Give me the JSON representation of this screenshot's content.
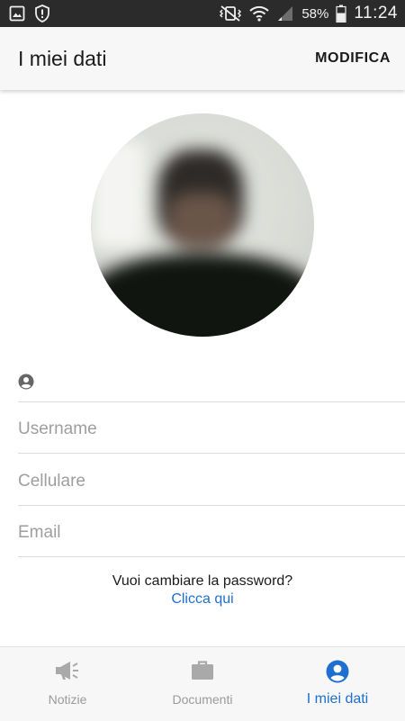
{
  "status_bar": {
    "battery_percent": "58%",
    "time": "11:24",
    "left_icons": [
      "image-icon",
      "shield-alert-icon"
    ],
    "right_icons": [
      "vibrate-mute-icon",
      "wifi-icon",
      "cellular-signal-icon",
      "battery-icon"
    ]
  },
  "app_bar": {
    "title": "I miei dati",
    "action_label": "MODIFICA"
  },
  "profile": {
    "avatar": "profile-photo",
    "user_icon": "account-circle-icon"
  },
  "form": {
    "username_placeholder": "Username",
    "username_value": "",
    "phone_placeholder": "Cellulare",
    "phone_value": "",
    "email_placeholder": "Email",
    "email_value": ""
  },
  "password": {
    "question": "Vuoi cambiare la password?",
    "link": "Clicca qui"
  },
  "bottom_nav": {
    "items": [
      {
        "label": "Notizie",
        "icon": "megaphone-icon",
        "active": false
      },
      {
        "label": "Documenti",
        "icon": "briefcase-icon",
        "active": false
      },
      {
        "label": "I miei dati",
        "icon": "account-circle-icon",
        "active": true
      }
    ]
  },
  "colors": {
    "accent": "#1f6fd0",
    "inactive_nav": "#9a9a9a",
    "status_bar_bg": "#2b2b2b",
    "app_bar_bg": "#f7f7f7"
  }
}
